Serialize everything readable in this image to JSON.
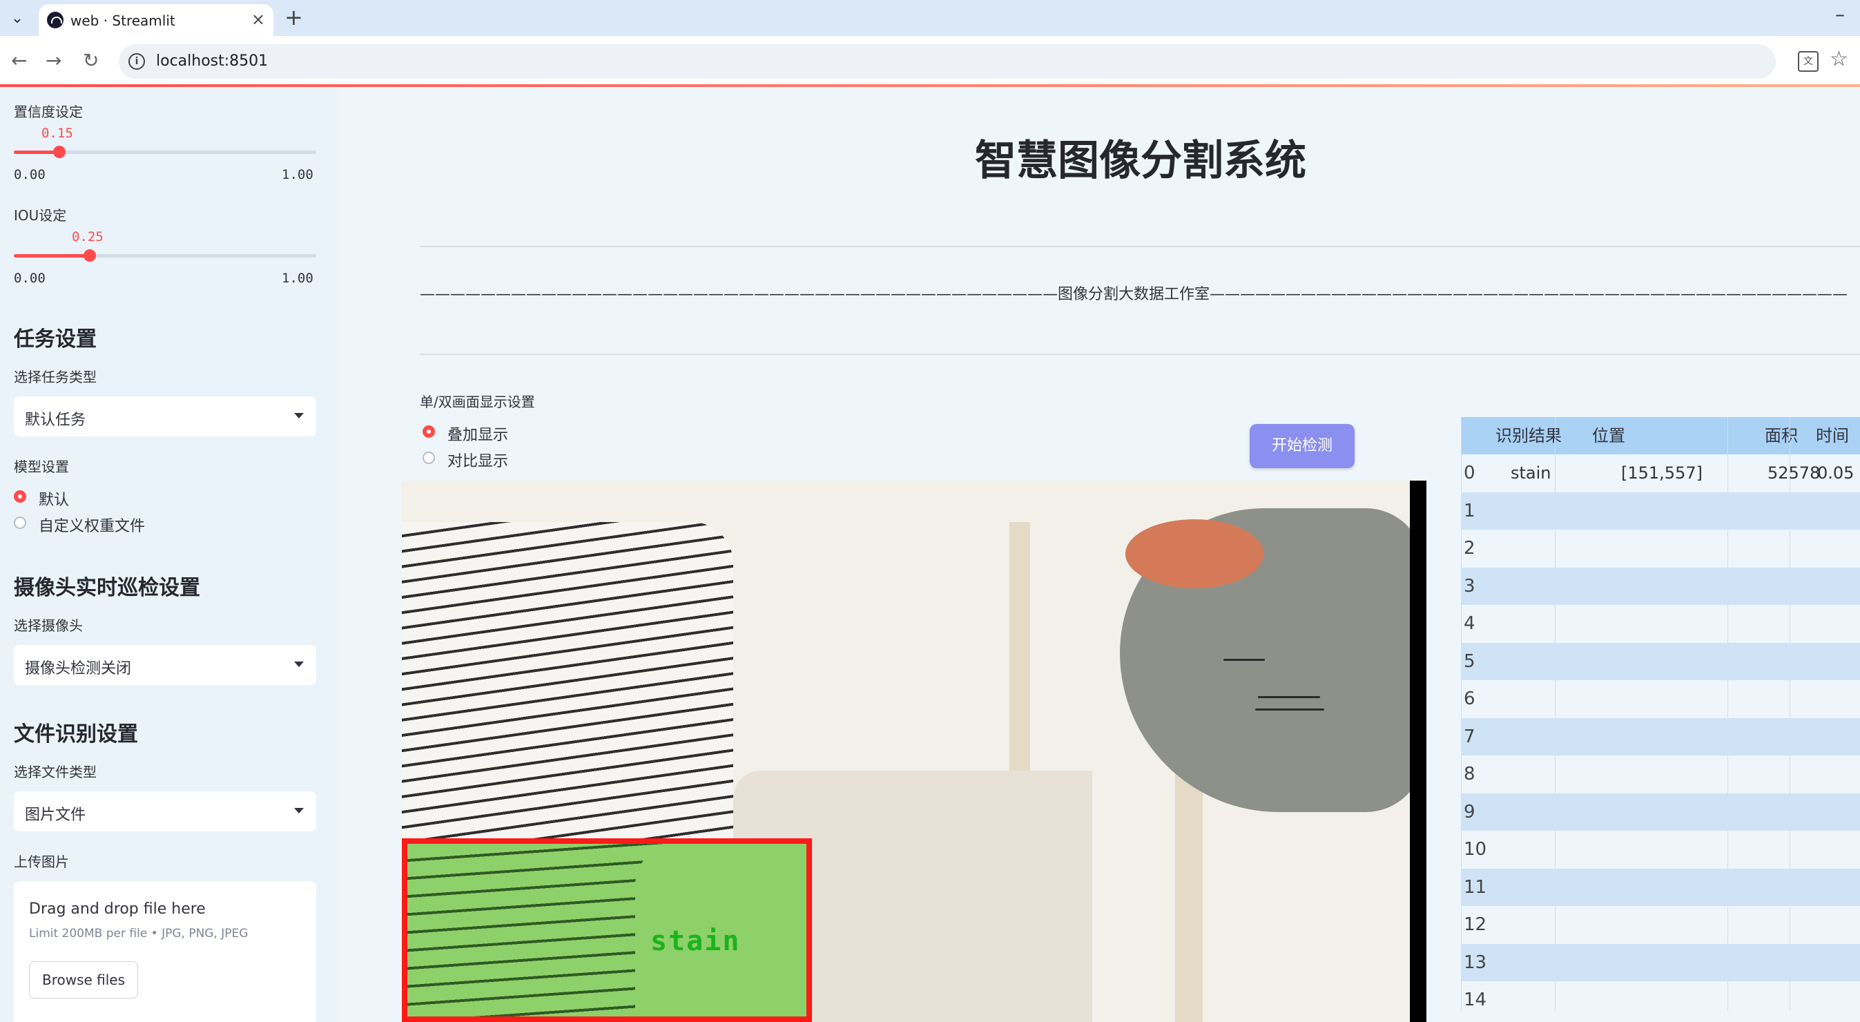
{
  "browser": {
    "tab_title": "web · Streamlit",
    "url": "localhost:8501",
    "new_tab": "+",
    "close": "×"
  },
  "sidebar": {
    "confidence": {
      "label": "置信度设定",
      "value": "0.15",
      "fraction": 0.15,
      "min": "0.00",
      "max": "1.00"
    },
    "iou": {
      "label": "IOU设定",
      "value": "0.25",
      "fraction": 0.25,
      "min": "0.00",
      "max": "1.00"
    },
    "task": {
      "heading": "任务设置",
      "label": "选择任务类型",
      "selected": "默认任务"
    },
    "model": {
      "label": "模型设置",
      "options": [
        "默认",
        "自定义权重文件"
      ],
      "selected_index": 0
    },
    "camera": {
      "heading": "摄像头实时巡检设置",
      "label": "选择摄像头",
      "selected": "摄像头检测关闭"
    },
    "file": {
      "heading": "文件识别设置",
      "label": "选择文件类型",
      "selected": "图片文件"
    },
    "upload": {
      "label": "上传图片",
      "title": "Drag and drop file here",
      "limit": "Limit 200MB per file • JPG, PNG, JPEG",
      "button": "Browse files"
    }
  },
  "main": {
    "title": "智慧图像分割系统",
    "divider_text": "——————————————————————————————————————————图像分割大数据工作室——————————————————————————————————————————",
    "display_mode": {
      "label": "单/双画面显示设置",
      "options": [
        "叠加显示",
        "对比显示"
      ],
      "selected_index": 0
    },
    "start_button": "开始检测",
    "detection": {
      "label": "stain",
      "box_color": "#ff1a1a",
      "mask_color": "#8ed16a"
    },
    "table": {
      "columns": [
        "识别结果",
        "位置",
        "面积",
        "时间"
      ],
      "rows": [
        {
          "index": "0",
          "result": "stain",
          "position": "[151,557]",
          "area": "52578",
          "time": "0.05"
        },
        {
          "index": "1"
        },
        {
          "index": "2"
        },
        {
          "index": "3"
        },
        {
          "index": "4"
        },
        {
          "index": "5"
        },
        {
          "index": "6"
        },
        {
          "index": "7"
        },
        {
          "index": "8"
        },
        {
          "index": "9"
        },
        {
          "index": "10"
        },
        {
          "index": "11"
        },
        {
          "index": "12"
        },
        {
          "index": "13"
        },
        {
          "index": "14"
        }
      ]
    }
  },
  "colors": {
    "accent": "#ff4b4b",
    "button": "#8a8ff0",
    "table_header": "#a9d2f5"
  }
}
